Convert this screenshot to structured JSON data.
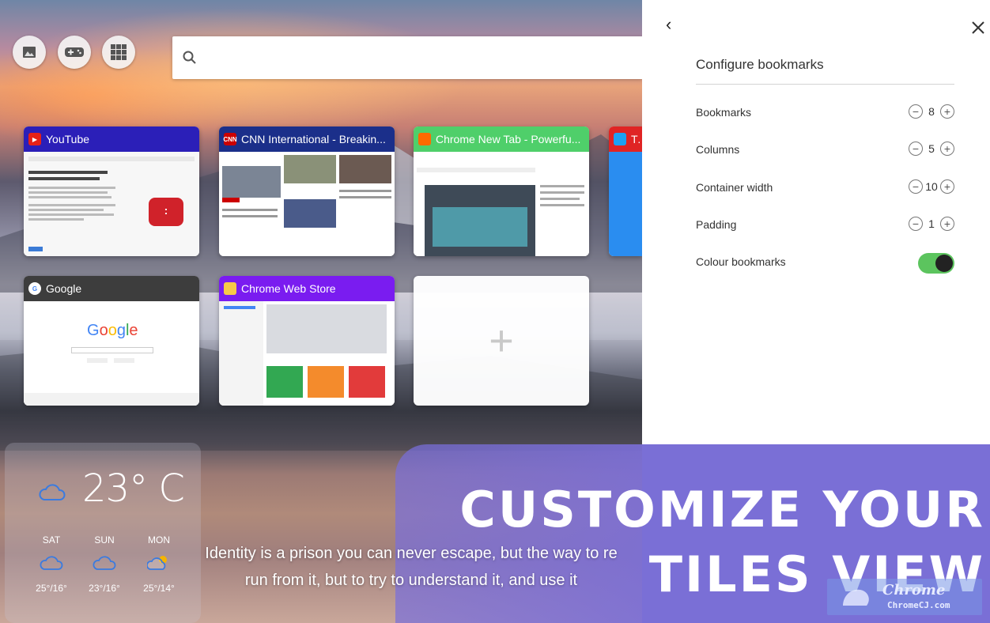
{
  "search": {
    "placeholder": ""
  },
  "toolbar": {
    "buttons": [
      {
        "icon": "image-icon"
      },
      {
        "icon": "gamepad-icon"
      },
      {
        "icon": "grid-icon"
      }
    ]
  },
  "tiles": [
    {
      "title": "YouTube",
      "header_color": "#2b1fb8",
      "favicon_color": "#e62117"
    },
    {
      "title": "CNN International - Breakin...",
      "header_color": "#1b2f8a",
      "favicon_color": "#cc0000",
      "favicon_text": "CNN"
    },
    {
      "title": "Chrome New Tab - Powerfu...",
      "header_color": "#4fcf6a",
      "favicon_color": "#ff6a00"
    },
    {
      "title": "Tw",
      "header_color": "#e02424",
      "favicon_color": "#1da1f2"
    },
    {
      "title": "Google",
      "header_color": "#3d3d3d",
      "favicon_color": "#ffffff"
    },
    {
      "title": "Chrome Web Store",
      "header_color": "#7a1cf0",
      "favicon_color": "#f7c948"
    }
  ],
  "add_tile": {
    "symbol": "+"
  },
  "settings": {
    "back_icon": "‹",
    "title": "Configure bookmarks",
    "rows": [
      {
        "label": "Bookmarks",
        "value": "8"
      },
      {
        "label": "Columns",
        "value": "5"
      },
      {
        "label": "Container width",
        "value": "10"
      },
      {
        "label": "Padding",
        "value": "1"
      }
    ],
    "toggle": {
      "label": "Colour bookmarks",
      "on": true,
      "color": "#5cc45e"
    }
  },
  "weather": {
    "temperature": "23° C",
    "forecast": [
      {
        "day": "SAT",
        "range": "25°/16°",
        "icon": "cloud-icon"
      },
      {
        "day": "SUN",
        "range": "23°/16°",
        "icon": "cloud-icon"
      },
      {
        "day": "MON",
        "range": "25°/14°",
        "icon": "partly-sunny-icon"
      }
    ]
  },
  "quote": {
    "line1": "Identity is a prison you can never escape, but the way to re",
    "line2": "run from it, but to try to understand it, and use it"
  },
  "promo": {
    "line1": "CUSTOMIZE YOUR",
    "line2": "TILES VIEW"
  },
  "watermark": {
    "main": "Chrome",
    "sub": "ChromeCJ.com"
  },
  "colors": {
    "accent": "#7a6fd6",
    "toggle": "#5cc45e"
  }
}
